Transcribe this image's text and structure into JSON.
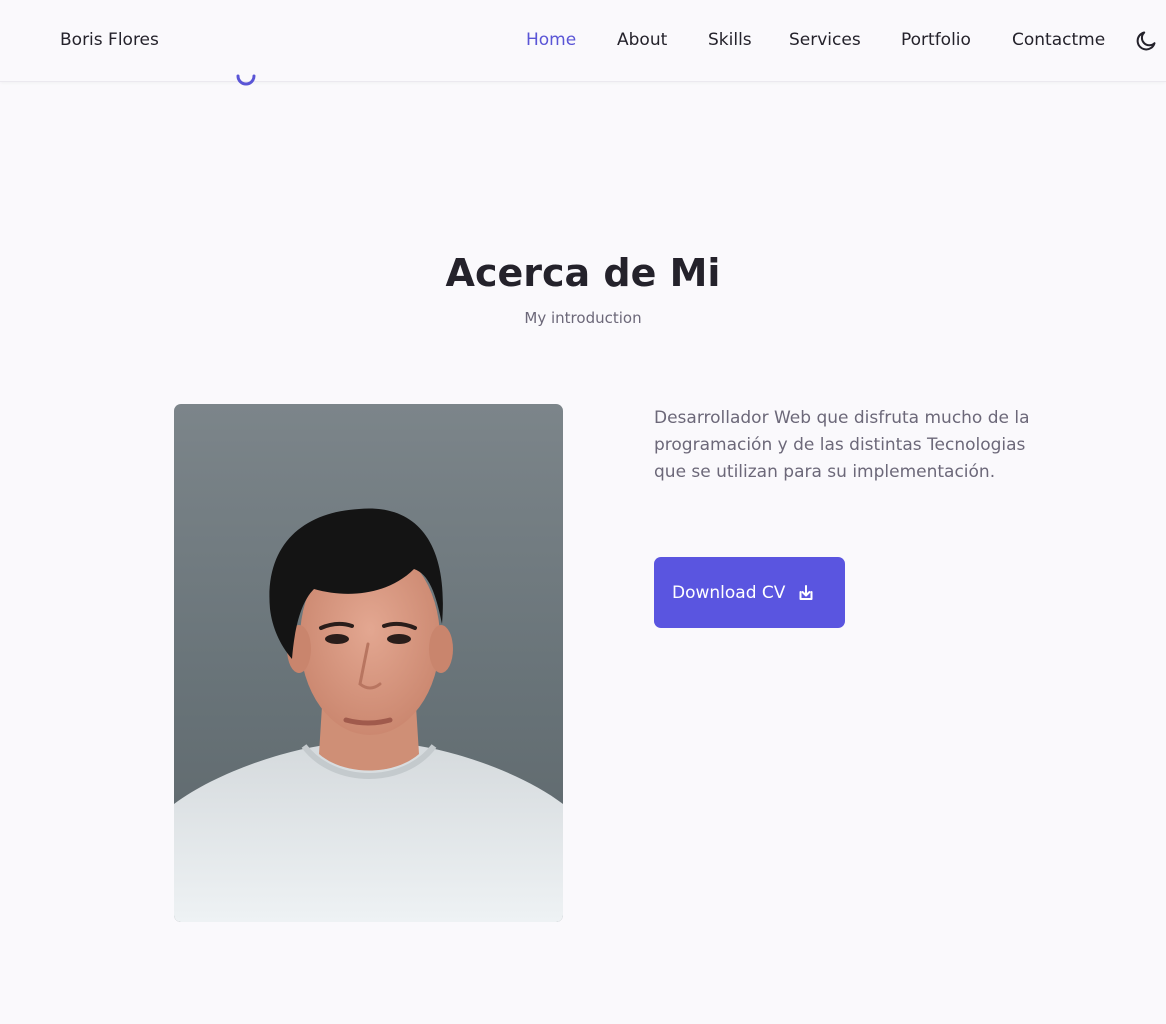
{
  "header": {
    "logo": "Boris Flores",
    "nav": [
      {
        "label": "Home",
        "active": true
      },
      {
        "label": "About",
        "active": false
      },
      {
        "label": "Skills",
        "active": false
      },
      {
        "label": "Services",
        "active": false
      },
      {
        "label": "Portfolio",
        "active": false
      },
      {
        "label": "Contactme",
        "active": false
      }
    ],
    "theme_icon": "moon-icon"
  },
  "about": {
    "title": "Acerca de Mi",
    "subtitle": "My introduction",
    "photo_alt": "profile-photo",
    "description": "Desarrollador Web que disfruta mucho de la programación y de las distintas Tecnologias que se utilizan para su implementación.",
    "download_button": {
      "label": "Download CV",
      "icon": "download-icon"
    }
  },
  "colors": {
    "accent": "#5a55e0",
    "title": "#24222b",
    "text": "#6c6879",
    "background": "#faf9fc"
  }
}
